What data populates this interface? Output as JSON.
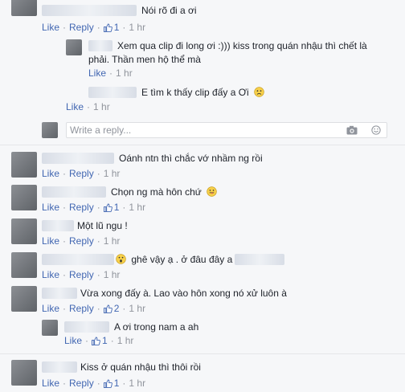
{
  "like_label": "Like",
  "reply_label": "Reply",
  "comments": [
    {
      "text": "Nói rõ đi a ơi",
      "likes": "1",
      "time": "1 hr"
    },
    {
      "text_line1": "Xem qua clip đi long ơi :))) kiss trong quán nhậu thì chết là",
      "text_line2": "phải. Thần men hộ thể mà",
      "time": "1 hr"
    },
    {
      "text": "E tìm k thấy clip đấy a Ơi",
      "emoji": "frown-emoji",
      "time": "1 hr"
    },
    {
      "text": "Oánh ntn thì chắc vớ nhầm ng rồi",
      "time": "1 hr"
    },
    {
      "text": "Chọn ng mà hôn chứ",
      "emoji": "tongue-emoji",
      "likes": "1",
      "time": "1 hr"
    },
    {
      "text": "Một lũ ngu !",
      "time": "1 hr"
    },
    {
      "text": "ghê vậy ạ . ở đâu đây a",
      "emoji": "surprised-emoji",
      "time": "1 hr"
    },
    {
      "text": "Vừa xong đấy à. Lao vào hôn xong nó xử luôn à",
      "likes": "2",
      "time": "1 hr"
    },
    {
      "text": "A ơi trong nam a ah",
      "likes": "1",
      "time": "1 hr"
    },
    {
      "text": "Kiss ở quán nhậu thì thôi rồi",
      "likes": "1",
      "time": "1 hr"
    }
  ],
  "reply_box": {
    "placeholder": "Write a reply...",
    "camera_icon": "camera-icon",
    "emoji_icon": "smiley-icon"
  },
  "colors": {
    "link": "#4267b2",
    "meta": "#90949c",
    "text": "#1d2129",
    "background": "#f6f7f9"
  }
}
